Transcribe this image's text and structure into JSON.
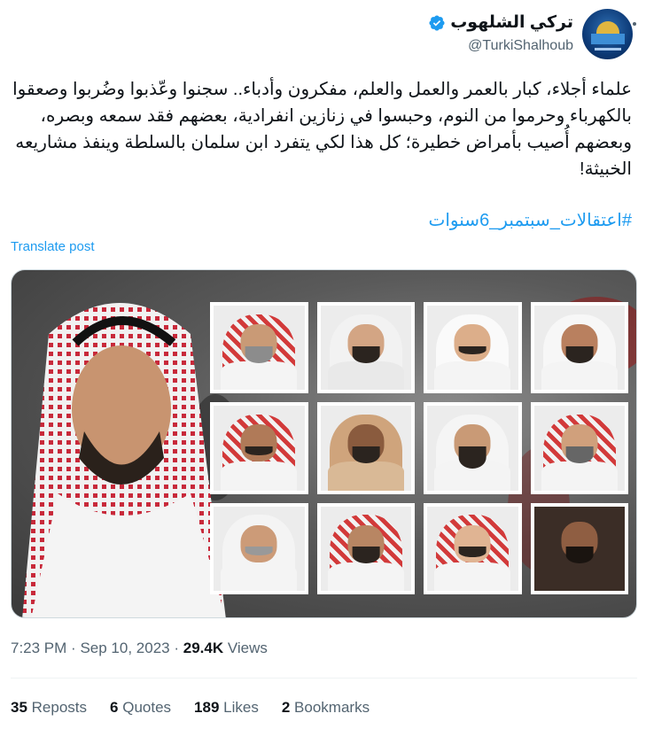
{
  "author": {
    "display_name": "تركي الشلهوب",
    "handle": "@TurkiShalhoub",
    "verified": true,
    "avatar_icon": "avatar-dome-of-the-rock"
  },
  "more_icon": "ellipsis-icon",
  "tweet": {
    "text": "علماء أجلاء، كبار بالعمر والعمل والعلم، مفكرون وأدباء.. سجنوا وعّذبوا وضُربوا وصعقوا بالكهرباء وحرموا من النوم، وحبسوا في زنازين انفرادية، بعضهم فقد سمعه وبصره، وبعضهم أُصيب بأمراض خطيرة؛ كل هذا لكي يتفرد ابن سلمان بالسلطة وينفذ مشاريعه الخبيثة!",
    "hashtag": "#اعتقالات_سبتمبر_6سنوات",
    "translate_label": "Translate post"
  },
  "meta": {
    "time": "7:23 PM",
    "separator": "·",
    "date": "Sep 10, 2023",
    "views_count": "29.4K",
    "views_label": "Views"
  },
  "stats": [
    {
      "count": "35",
      "label": "Reposts"
    },
    {
      "count": "6",
      "label": "Quotes"
    },
    {
      "count": "189",
      "label": "Likes"
    },
    {
      "count": "2",
      "label": "Bookmarks"
    }
  ],
  "colors": {
    "link": "#1d9bf0",
    "secondary_text": "#536471",
    "primary_text": "#0f1419",
    "verified": "#1d9bf0"
  }
}
